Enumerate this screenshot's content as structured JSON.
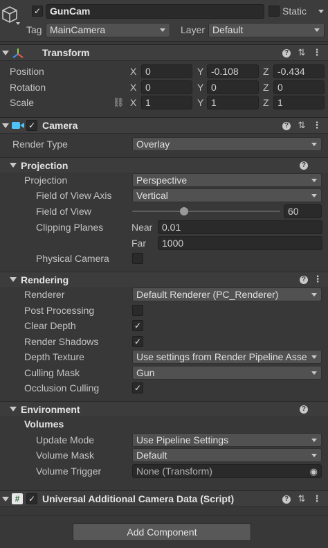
{
  "object": {
    "name": "GunCam",
    "static_label": "Static",
    "tag_label": "Tag",
    "tag_value": "MainCamera",
    "layer_label": "Layer",
    "layer_value": "Default"
  },
  "transform": {
    "title": "Transform",
    "position_label": "Position",
    "rotation_label": "Rotation",
    "scale_label": "Scale",
    "axis_x": "X",
    "axis_y": "Y",
    "axis_z": "Z",
    "position": {
      "x": "0",
      "y": "-0.108",
      "z": "-0.434"
    },
    "rotation": {
      "x": "0",
      "y": "0",
      "z": "0"
    },
    "scale": {
      "x": "1",
      "y": "1",
      "z": "1"
    }
  },
  "camera": {
    "title": "Camera",
    "render_type_label": "Render Type",
    "render_type_value": "Overlay",
    "projection": {
      "title": "Projection",
      "projection_label": "Projection",
      "projection_value": "Perspective",
      "fov_axis_label": "Field of View Axis",
      "fov_axis_value": "Vertical",
      "fov_label": "Field of View",
      "fov_value": "60",
      "fov_slider_fraction": 0.34,
      "clipping_label": "Clipping Planes",
      "near_label": "Near",
      "near_value": "0.01",
      "far_label": "Far",
      "far_value": "1000",
      "physical_camera_label": "Physical Camera",
      "physical_camera_checked": false
    },
    "rendering": {
      "title": "Rendering",
      "renderer_label": "Renderer",
      "renderer_value": "Default Renderer (PC_Renderer)",
      "post_processing_label": "Post Processing",
      "clear_depth_label": "Clear Depth",
      "render_shadows_label": "Render Shadows",
      "depth_texture_label": "Depth Texture",
      "depth_texture_value": "Use settings from Render Pipeline Asse",
      "culling_mask_label": "Culling Mask",
      "culling_mask_value": "Gun",
      "occlusion_culling_label": "Occlusion Culling",
      "check_mark": "✓"
    },
    "environment": {
      "title": "Environment",
      "volumes_title": "Volumes",
      "update_mode_label": "Update Mode",
      "update_mode_value": "Use Pipeline Settings",
      "volume_mask_label": "Volume Mask",
      "volume_mask_value": "Default",
      "volume_trigger_label": "Volume Trigger",
      "volume_trigger_value": "None (Transform)"
    }
  },
  "additional_data": {
    "title": "Universal Additional Camera Data (Script)"
  },
  "add_component_label": "Add Component",
  "icons": {
    "help": "?",
    "presets": "⇅",
    "menu": "⋮",
    "link": "⛓",
    "script": "#",
    "target": "◉"
  },
  "colors": {
    "background": "#383838",
    "header": "#3e3e3e",
    "field": "#2a2a2a",
    "dropdown": "#515151",
    "camera_icon": "#4ec3f7"
  }
}
